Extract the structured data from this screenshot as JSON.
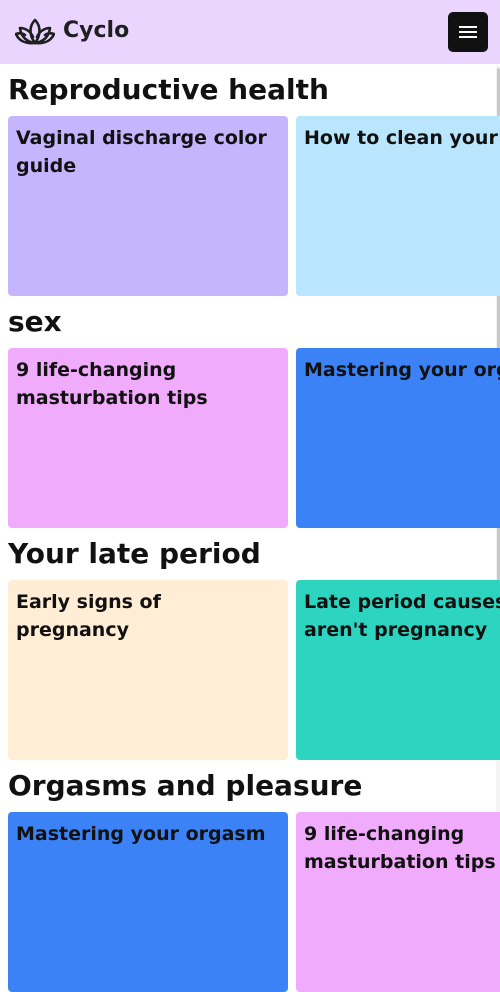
{
  "header": {
    "brand": "Cyclo",
    "logo_icon": "lotus-icon",
    "menu_icon": "hamburger-menu-icon",
    "background": "#e9d5ff"
  },
  "sections": [
    {
      "title": "Reproductive health",
      "cards": [
        {
          "title": "Vaginal discharge color guide",
          "color": "#c4b5fd"
        },
        {
          "title": "How to clean your va",
          "color": "#bae6fd"
        }
      ]
    },
    {
      "title": "sex",
      "cards": [
        {
          "title": "9 life-changing masturbation tips",
          "color": "#f0abfc"
        },
        {
          "title": "Mastering your orga",
          "color": "#3b82f6"
        }
      ]
    },
    {
      "title": "Your late period",
      "cards": [
        {
          "title": "Early signs of pregnancy",
          "color": "#ffedd5"
        },
        {
          "title": "Late period causes t aren't pregnancy",
          "color": "#2dd4bf"
        }
      ]
    },
    {
      "title": "Orgasms and pleasure",
      "cards": [
        {
          "title": "Mastering your orgasm",
          "color": "#3b82f6"
        },
        {
          "title": "9 life-changing masturbation tips",
          "color": "#f0abfc"
        }
      ]
    }
  ]
}
